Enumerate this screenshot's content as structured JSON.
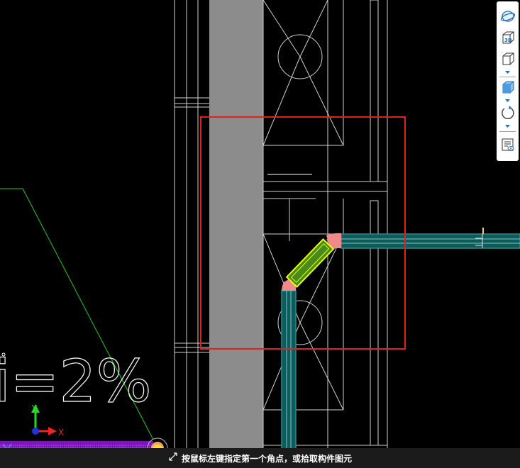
{
  "window": {
    "app": "CAD pipe drawing editor",
    "status_prompt": "按鼠标左键指定第一个角点，或拾取构件图元"
  },
  "drawing": {
    "slope_label": "i=2%",
    "axis_x": "X",
    "axis_y": "Y",
    "colors": {
      "background": "#000000",
      "wall": "#8c8c8c",
      "pipe": "#0f5a5a",
      "pipe_stroke": "#2a8c8c",
      "pipe_center": "#7fc7c7",
      "elbow": "#f08a8a",
      "selection_fill": "#4a8a1a",
      "selection_stroke": "#e6ff00",
      "selection_box": "#e02020",
      "slope_line": "#22cc22",
      "hatch": "#7a16b8"
    }
  },
  "toolbar": {
    "items": [
      {
        "name": "view-orbit",
        "icon": "orbit-icon"
      },
      {
        "name": "view-3d",
        "icon": "cube-3d-icon",
        "label": "3D"
      },
      {
        "name": "view-box",
        "icon": "box-icon"
      },
      {
        "name": "view-solid",
        "icon": "solid-cube-icon"
      },
      {
        "name": "rotate",
        "icon": "rotate-icon"
      },
      {
        "name": "properties",
        "icon": "properties-icon"
      }
    ]
  }
}
